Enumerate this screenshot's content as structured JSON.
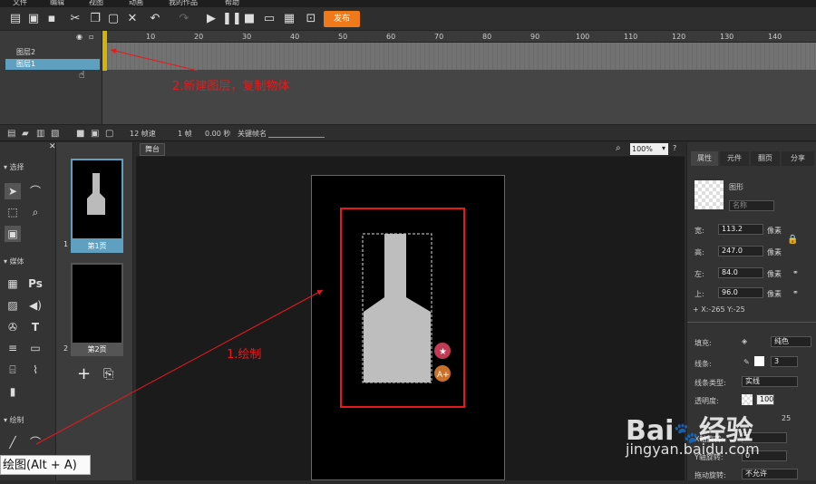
{
  "menu": [
    "文件",
    "编辑",
    "视图",
    "动画",
    "我的作品",
    "帮助"
  ],
  "toolbar": {
    "publish": "发布"
  },
  "layers": [
    {
      "name": "图层2"
    },
    {
      "name": "图层1"
    }
  ],
  "ruler_ticks": [
    "10",
    "20",
    "30",
    "40",
    "50",
    "60",
    "70",
    "80",
    "90",
    "100",
    "110",
    "120",
    "130",
    "140"
  ],
  "timeline_status": {
    "fps": "12 帧速",
    "frame": "1 帧",
    "time": "0.00 秒",
    "keyframe": "关键帧名"
  },
  "tools": {
    "select": "选择",
    "media": "媒体",
    "draw": "绘制"
  },
  "pages": [
    {
      "num": "1",
      "label": "第1页"
    },
    {
      "num": "2",
      "label": "第2页"
    }
  ],
  "stage": {
    "tab": "舞台",
    "zoom": "100%"
  },
  "props": {
    "tabs": [
      "属性",
      "元件",
      "翻页",
      "分享"
    ],
    "shape_label": "图形",
    "name_placeholder": "名称",
    "width_label": "宽:",
    "width": "113.2",
    "height_label": "高:",
    "height": "247.0",
    "left_label": "左:",
    "left": "84.0",
    "top_label": "上:",
    "top": "96.0",
    "unit": "像素",
    "coords": "X:-265   Y:-25",
    "fill_label": "填充:",
    "fill_type": "纯色",
    "stroke_label": "线条:",
    "stroke_width": "3",
    "stroke_type_label": "线条类型:",
    "stroke_type": "实线",
    "opacity_label": "透明度:",
    "opacity": "100",
    "x_rot_label": "X轴旋转:",
    "x_rot": "0",
    "y_rot_label": "Y轴旋转:",
    "y_rot": "0",
    "drag_label": "拖动旋转:",
    "drag": "不允许",
    "value25": "25"
  },
  "annotations": {
    "step2": "2.新建图层，复制物体",
    "step1": "1.绘制"
  },
  "tooltip": "绘图(Alt + A)",
  "watermark": {
    "brand": "Bai",
    "brand2": "经验",
    "url": "jingyan.baidu.com"
  },
  "colors": {
    "accent": "#f07a1a",
    "annotation": "#e8191c",
    "selection": "#5fa0c0"
  }
}
